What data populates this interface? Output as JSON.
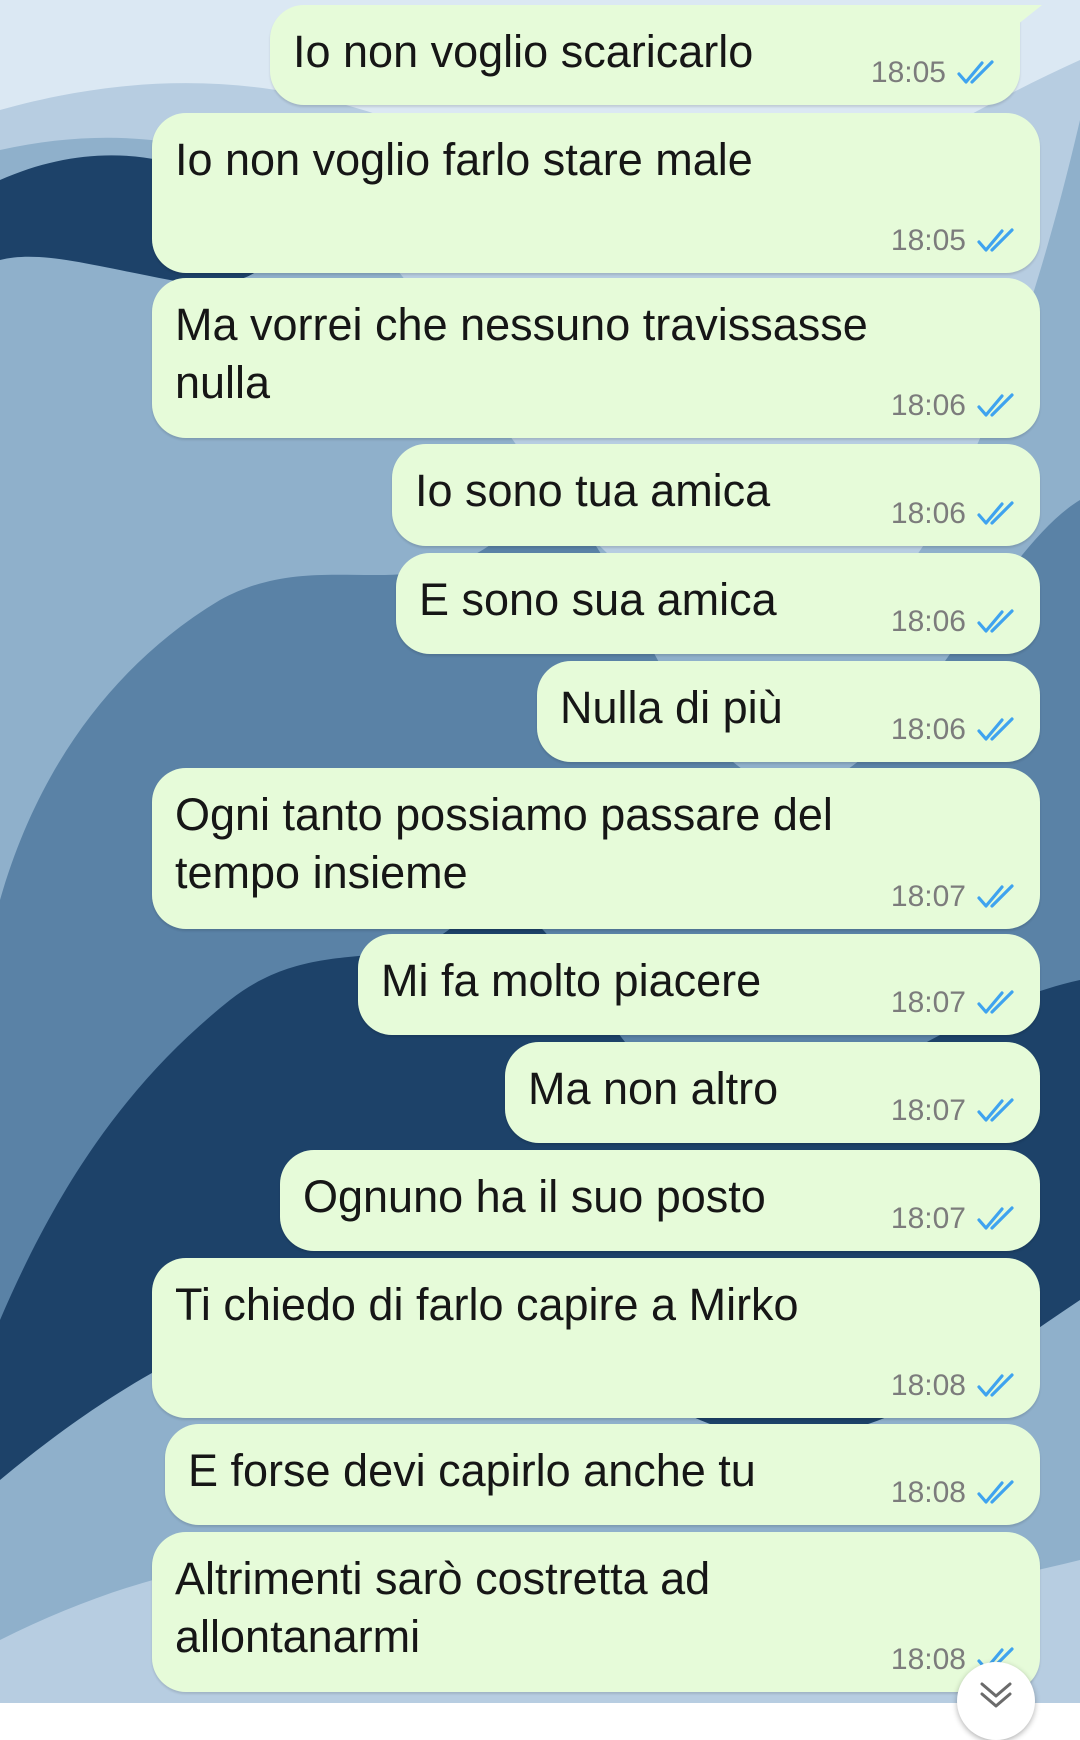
{
  "wallpaper": {
    "background": "#dbe8f3",
    "band_colors": [
      "#b7cde1",
      "#8fb0cb",
      "#5a82a6",
      "#1d4269"
    ]
  },
  "messages": [
    {
      "text": "Io non voglio scaricarlo",
      "time": "18:05"
    },
    {
      "text": "Io non voglio farlo stare male",
      "time": "18:05"
    },
    {
      "text": "Ma vorrei che nessuno travissasse nulla",
      "time": "18:06"
    },
    {
      "text": "Io sono tua amica",
      "time": "18:06"
    },
    {
      "text": "E sono sua amica",
      "time": "18:06"
    },
    {
      "text": "Nulla di più",
      "time": "18:06"
    },
    {
      "text": "Ogni tanto possiamo passare del tempo insieme",
      "time": "18:07"
    },
    {
      "text": "Mi fa molto piacere",
      "time": "18:07"
    },
    {
      "text": "Ma non altro",
      "time": "18:07"
    },
    {
      "text": "Ognuno ha il suo posto",
      "time": "18:07"
    },
    {
      "text": "Ti chiedo di farlo capire a Mirko",
      "time": "18:08"
    },
    {
      "text": "E forse devi capirlo anche tu",
      "time": "18:08"
    },
    {
      "text": "Altrimenti sarò costretta ad allontanarmi",
      "time": "18:08"
    }
  ],
  "colors": {
    "bubble": "#e6fbd9",
    "read_check": "#3fa3ef",
    "time": "#7c7c7c"
  },
  "icons": {
    "status": "double-check-icon",
    "scroll": "chevron-down-icon"
  }
}
